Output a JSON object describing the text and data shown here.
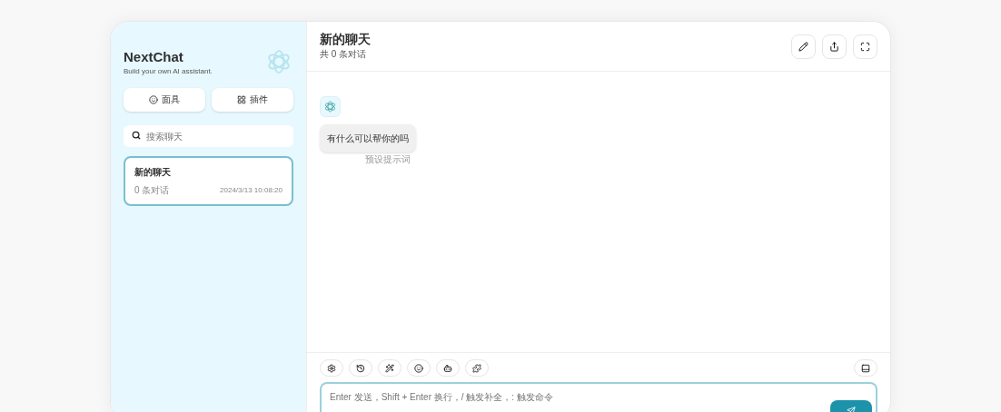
{
  "sidebar": {
    "title": "NextChat",
    "subtitle": "Build your own AI assistant.",
    "buttons": [
      {
        "label": "面具",
        "kind": "mask"
      },
      {
        "label": "插件",
        "kind": "plugin"
      }
    ],
    "search": {
      "placeholder": "搜索聊天"
    },
    "chats": [
      {
        "title": "新的聊天",
        "count": "0 条对话",
        "time": "2024/3/13 10:08:20",
        "selected": true
      }
    ]
  },
  "header": {
    "title": "新的聊天",
    "subtitle": "共 0 条对话"
  },
  "messages": [
    {
      "text": "有什么可以帮你的吗",
      "note": "预设提示词"
    }
  ],
  "input": {
    "placeholder": "Enter 发送，Shift + Enter 换行，/ 触发补全，: 触发命令"
  }
}
